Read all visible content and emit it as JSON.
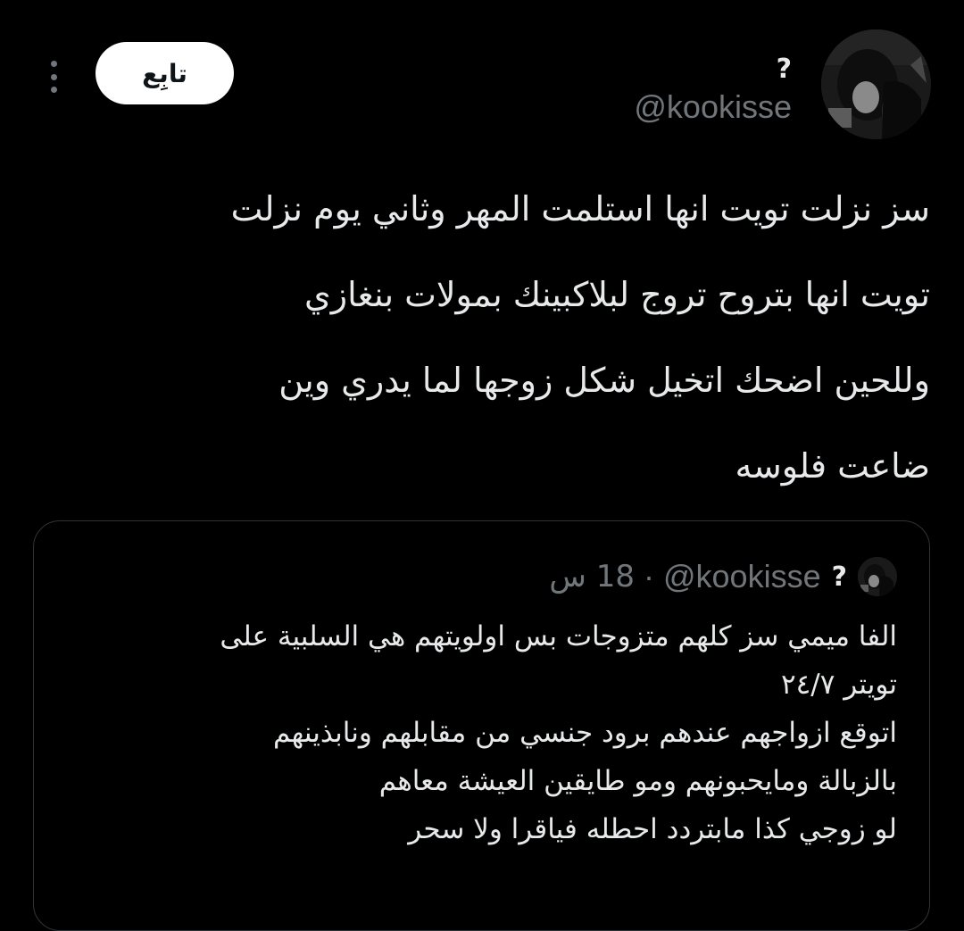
{
  "tweet": {
    "follow_label": "تابِع",
    "author_name": "?",
    "author_handle": "@kookisse",
    "text_lines": [
      "سز نزلت تويت انها استلمت المهر وثاني يوم نزلت",
      "تويت انها بتروح تروج لبلاكبينك بمولات بنغازي",
      "وللحين اضحك اتخيل شكل زوجها لما يدري وين",
      "ضاعت فلوسه"
    ]
  },
  "quoted_tweet": {
    "author_name": "?",
    "author_handle": "@kookisse",
    "separator": "·",
    "time": "18 س",
    "text_lines": [
      "الفا ميمي سز كلهم متزوجات بس اولويتهم هي السلبية على",
      "تويتر ٢٤/٧",
      "اتوقع ازواجهم عندهم برود جنسي من مقابلهم ونابذينهم",
      "بالزبالة ومايحبونهم ومو طايقين العيشة معاهم",
      "لو زوجي كذا مابتردد احطله فياقرا ولا سحر"
    ]
  },
  "colors": {
    "background": "#000000",
    "text_primary": "#e7e9ea",
    "text_secondary": "#71767b",
    "follow_button_bg": "#ffffff",
    "quote_border": "#2f3336"
  },
  "icons": {
    "more": "more-vertical-icon"
  }
}
